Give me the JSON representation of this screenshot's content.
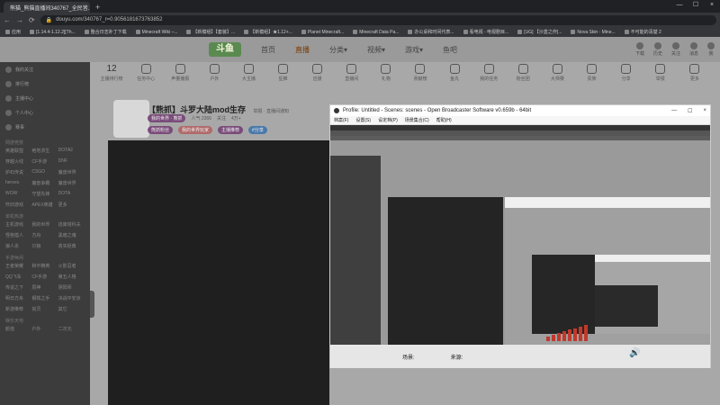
{
  "browser": {
    "tab_title": "熊猫_熊猫直播间340767_全民皆...",
    "tab_close": "×",
    "new_tab": "+",
    "window_controls": [
      "—",
      "☐",
      "×"
    ],
    "url": "douyu.com/340767_r=0.9056181673763852",
    "back": "←",
    "forward": "→",
    "reload": "⟳"
  },
  "bookmarks": [
    "应用",
    "[1.14.4-1.12.2][Th...",
    "整合日志补丁下载",
    "Minecraft Wiki –...",
    "【新模组】【套装】...",
    "【新模组】★1.12+...",
    "Planet Minecraft...",
    "Minecraft Data Pa...",
    "办公桌和时间代表...",
    "看电视 - 电视剧目...",
    "[UG] 【沙盒之作]...",
    "Nova Skin - Mine...",
    "不可能的清楚 2"
  ],
  "site": {
    "logo": "斗鱼",
    "nav": [
      "首页",
      "直播",
      "分类▾",
      "视频▾",
      "游戏▾",
      "鱼吧"
    ],
    "active_nav": "直播",
    "header_right": [
      "下载",
      "历史",
      "关注",
      "消息",
      "我"
    ]
  },
  "sidebar": {
    "items": [
      "我的关注",
      "排行榜",
      "主播中心",
      "个人中心",
      "赛事"
    ],
    "sections": [
      {
        "title": "网游竞技",
        "entries": [
          "英雄联盟",
          "绝地求生",
          "DOTA2",
          "穿越火线",
          "CF手游",
          "DNF",
          "炉石传说",
          "CSGO",
          "魔兽世界",
          "heroes",
          "魔兽争霸",
          "魔兽世界",
          "WOW",
          "守望先锋",
          "DOTA",
          "怀旧游戏",
          "APEX英雄",
          "更多"
        ]
      },
      {
        "title": "单机热游",
        "entries": [
          "主机游戏",
          "我的世界",
          "逃离塔科夫",
          "怪物猎人",
          "方舟",
          "黑暗之魂",
          "狼人杀",
          "只狼",
          "真实经典"
        ]
      },
      {
        "title": "手游休闲",
        "entries": [
          "王者荣耀",
          "和平精英",
          "火影忍者",
          "QQ飞车",
          "CF手游",
          "第五人格",
          "传说之下",
          "原神",
          "阴阳师",
          "明日方舟",
          "钢铁之手",
          "决战平安京",
          "新游推荐",
          "剑灵",
          "其它"
        ]
      },
      {
        "title": "娱乐天地",
        "entries": [
          "颜值",
          "户外",
          "二次元"
        ]
      }
    ]
  },
  "icons_row": [
    {
      "label": "12",
      "sub": "主播排行榜"
    },
    {
      "label": "任务中心"
    },
    {
      "label": "声量播报"
    },
    {
      "label": "户外"
    },
    {
      "label": "大主播"
    },
    {
      "label": "星推"
    },
    {
      "label": "应援"
    },
    {
      "label": "直播间"
    },
    {
      "label": "礼物"
    },
    {
      "label": "贡献榜"
    },
    {
      "label": "鱼丸"
    },
    {
      "label": "我的任务"
    },
    {
      "label": "粉丝团"
    },
    {
      "label": "大师赛"
    },
    {
      "label": "贵族"
    },
    {
      "label": "分享"
    },
    {
      "label": "举报"
    },
    {
      "label": "更多"
    }
  ],
  "stream": {
    "title": "【熊抓】斗罗大陆mod生存",
    "title_sub": "举报 · 直播间通知",
    "meta": [
      "我的世界 · 熊抓",
      "人气 2366",
      "关注",
      "4万+"
    ],
    "tags": [
      "熊抓粉丝",
      "我的世界玩家",
      "主播推荐",
      "#分享"
    ]
  },
  "obs": {
    "title": "Profile: Untitled - Scenes: scenes - Open Broadcaster Software v0.659b - 64bit",
    "menu": [
      "档案(F)",
      "设置(S)",
      "设定档(P)",
      "场景集合(C)",
      "帮助(H)"
    ],
    "scenes_label": "场景:",
    "sources_label": "来源:"
  },
  "audio": {
    "levels": [
      0.3,
      0.4,
      0.5,
      0.6,
      0.7,
      0.8,
      0.9,
      1.0
    ],
    "color": "#c0392b"
  }
}
